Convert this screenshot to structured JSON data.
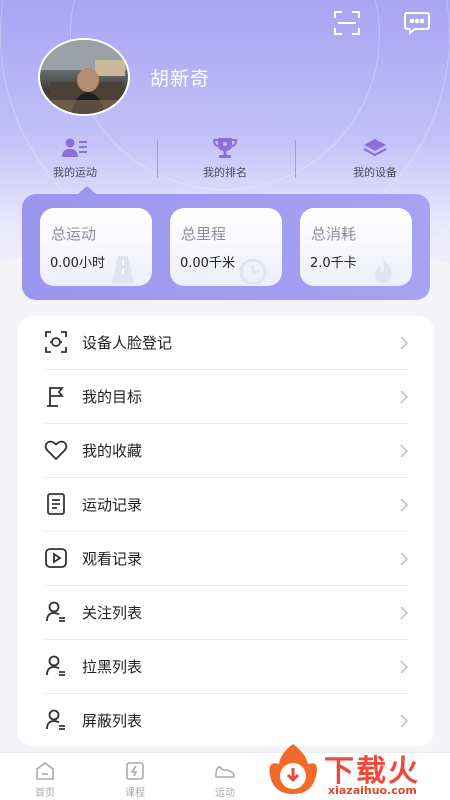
{
  "profile": {
    "username": "胡新奇"
  },
  "top_icons": [
    "scan-icon",
    "message-icon"
  ],
  "tabs": [
    {
      "label": "我的运动",
      "icon": "user-list-icon"
    },
    {
      "label": "我的排名",
      "icon": "trophy-icon"
    },
    {
      "label": "我的设备",
      "icon": "layers-icon"
    }
  ],
  "stats": [
    {
      "title": "总运动",
      "value": "0.00小时",
      "icon": "road-icon"
    },
    {
      "title": "总里程",
      "value": "0.00千米",
      "icon": "clock-icon"
    },
    {
      "title": "总消耗",
      "value": "2.0千卡",
      "icon": "flame-icon"
    }
  ],
  "menu": [
    {
      "label": "设备人脸登记",
      "icon": "face-scan-icon"
    },
    {
      "label": "我的目标",
      "icon": "flag-icon"
    },
    {
      "label": "我的收藏",
      "icon": "heart-icon"
    },
    {
      "label": "运动记录",
      "icon": "document-icon"
    },
    {
      "label": "观看记录",
      "icon": "play-icon"
    },
    {
      "label": "关注列表",
      "icon": "user-icon"
    },
    {
      "label": "拉黑列表",
      "icon": "user-icon"
    },
    {
      "label": "屏蔽列表",
      "icon": "user-icon"
    }
  ],
  "bottom_nav": [
    {
      "label": "首页",
      "icon": "home-icon"
    },
    {
      "label": "课程",
      "icon": "course-icon"
    },
    {
      "label": "运动",
      "icon": "shoe-icon"
    }
  ],
  "watermark": {
    "title": "下载火",
    "url": "xiazaihuo.com"
  },
  "colors": {
    "accent": "#9a95ee",
    "tab_icon": "#8d6fd9",
    "menu_text": "#222222",
    "watermark": "#ee4a3a"
  }
}
